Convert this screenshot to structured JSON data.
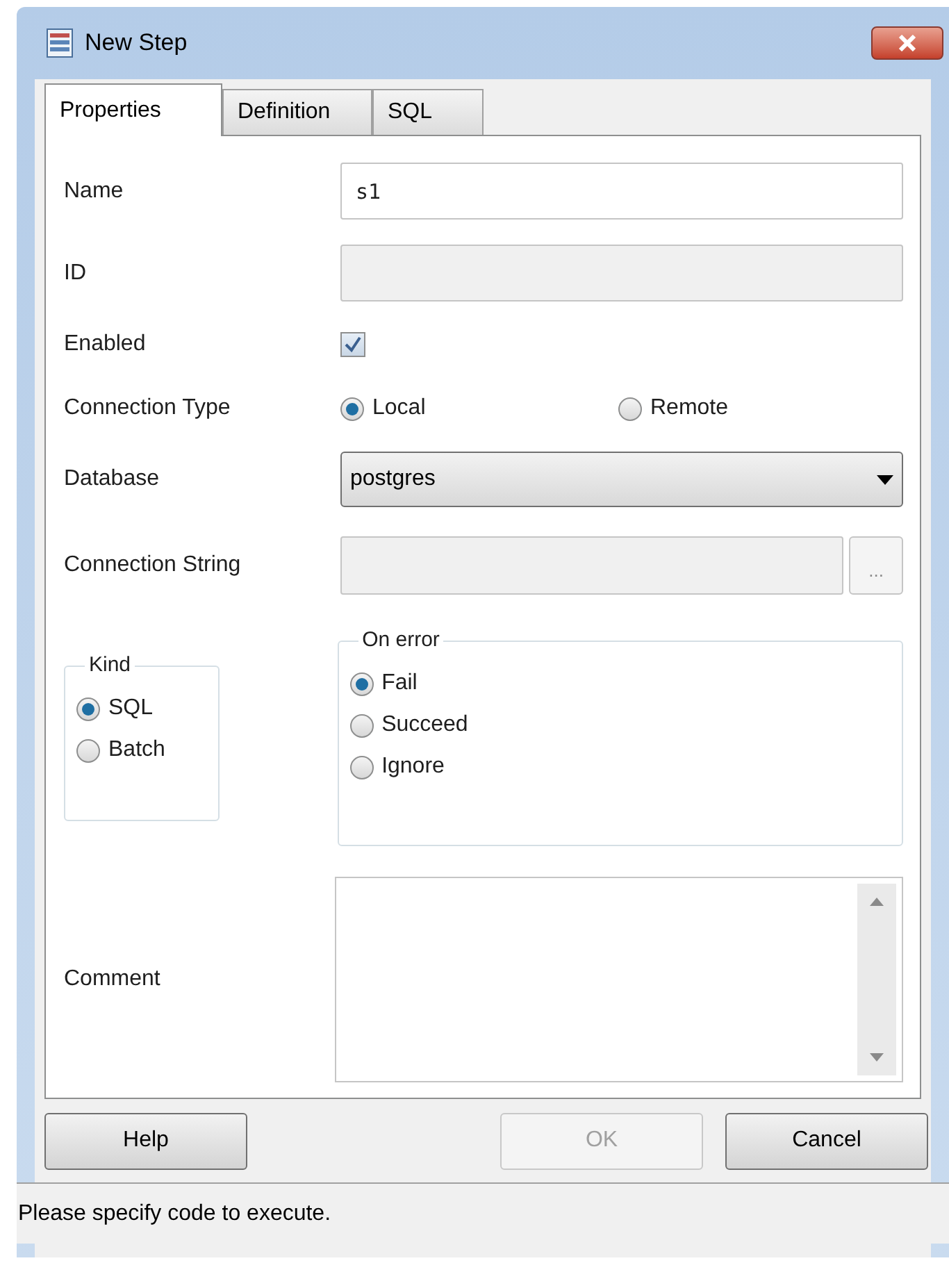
{
  "window": {
    "title": "New Step"
  },
  "tabs": [
    {
      "label": "Properties",
      "selected": true
    },
    {
      "label": "Definition",
      "selected": false
    },
    {
      "label": "SQL",
      "selected": false
    }
  ],
  "fields": [
    {
      "kind": "text",
      "label": "Name",
      "value": "s1",
      "disabled": false
    },
    {
      "kind": "text",
      "label": "ID",
      "disabled": true
    },
    {
      "kind": "checkbox",
      "label": "Enabled",
      "checked": true
    },
    {
      "kind": "radio",
      "label": "Connection Type",
      "options": [
        {
          "label": "Local",
          "selected": true
        },
        {
          "label": "Remote",
          "selected": false
        }
      ]
    },
    {
      "kind": "dropdown",
      "label": "Database",
      "value": "postgres"
    },
    {
      "kind": "browse",
      "label": "Connection String",
      "disabled": true,
      "button": "..."
    }
  ],
  "kind_group": {
    "title": "Kind",
    "options": [
      {
        "label": "SQL",
        "selected": true
      },
      {
        "label": "Batch",
        "selected": false
      }
    ]
  },
  "on_error": {
    "title": "On error",
    "options": [
      {
        "label": "Fail",
        "selected": true
      },
      {
        "label": "Succeed",
        "selected": false
      },
      {
        "label": "Ignore",
        "selected": false
      }
    ]
  },
  "comment": {
    "label": "Comment"
  },
  "buttons": [
    {
      "label": "Help",
      "disabled": false
    },
    {
      "label": "OK",
      "disabled": true
    },
    {
      "label": "Cancel",
      "disabled": false
    }
  ],
  "status_bar": "Please specify code to execute."
}
